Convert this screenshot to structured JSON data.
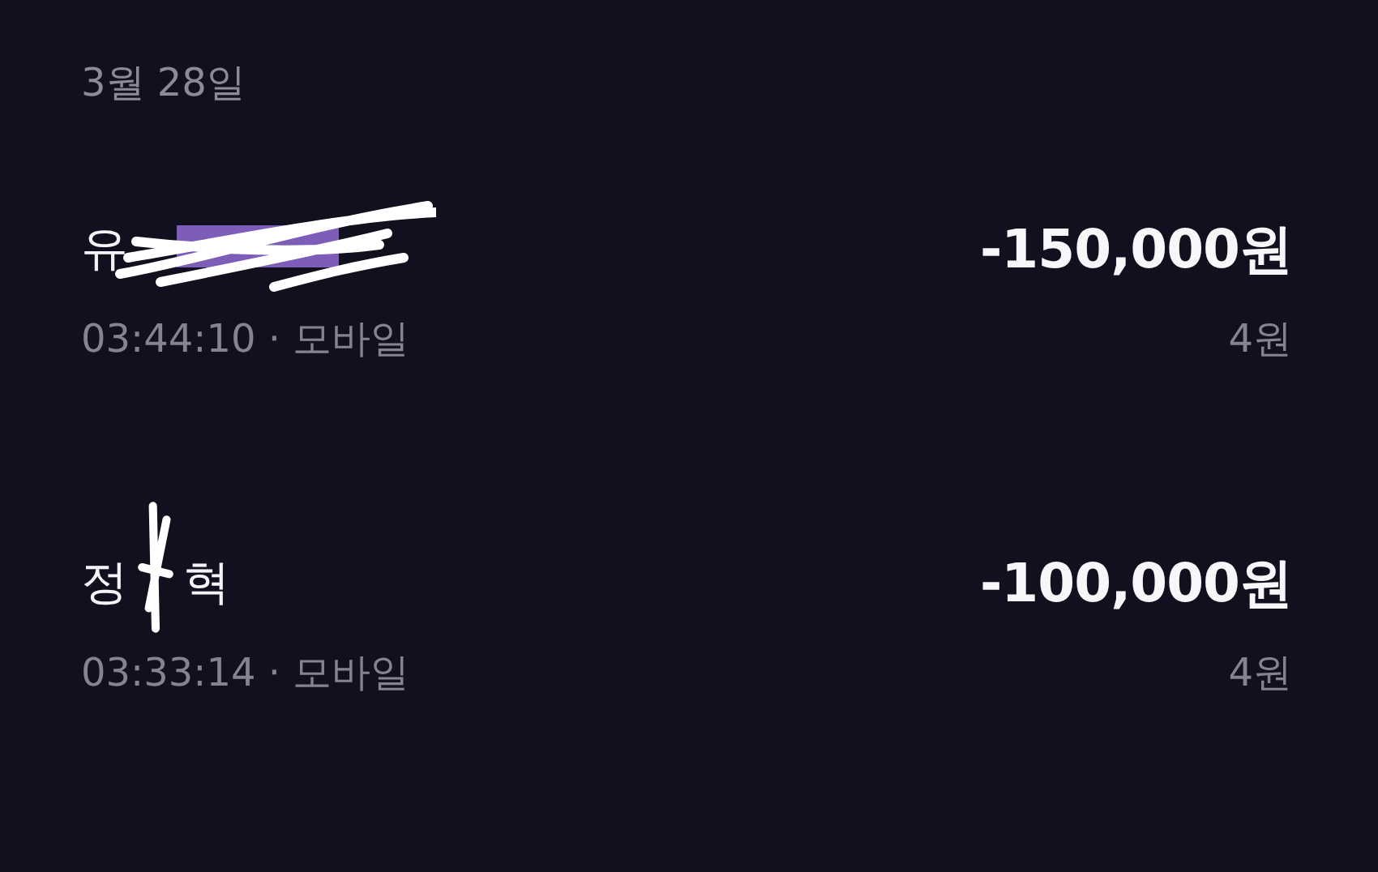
{
  "date": "3월 28일",
  "transactions": [
    {
      "name_fragments": [
        "유"
      ],
      "redaction": {
        "kind": "zigzag"
      },
      "amount": "-150,000원",
      "time": "03:44:10",
      "separator": "·",
      "channel": "모바일",
      "balance": "4원"
    },
    {
      "name_fragments": [
        "정",
        "혁"
      ],
      "redaction": {
        "kind": "vertical"
      },
      "amount": "-100,000원",
      "time": "03:33:14",
      "separator": "·",
      "channel": "모바일",
      "balance": "4원"
    }
  ]
}
